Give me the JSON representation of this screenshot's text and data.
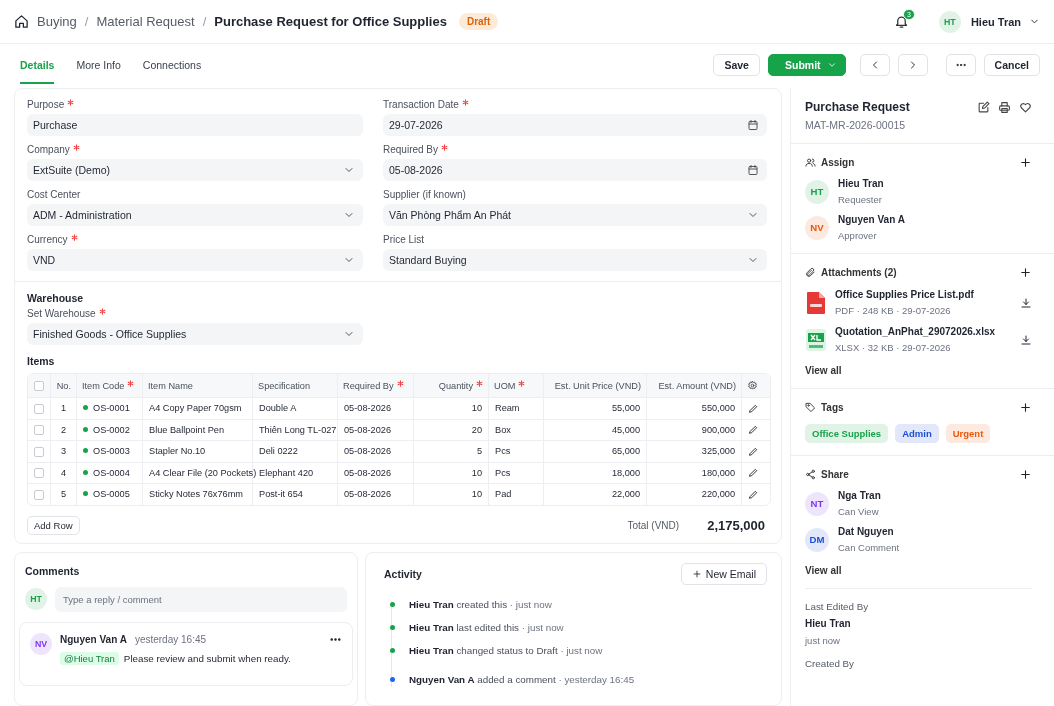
{
  "breadcrumb": [
    {
      "label": "Buying",
      "separator": "/"
    },
    {
      "label": "Material Request",
      "separator": "/"
    }
  ],
  "title": "Purchase Request for Office Supplies",
  "status": "Draft",
  "notifications": "3",
  "user": {
    "initials": "HT",
    "name": "Hieu Tran",
    "color": "#16a34a"
  },
  "tabs": [
    {
      "label": "Details",
      "selected": true
    },
    {
      "label": "More Info",
      "selected": false
    },
    {
      "label": "Connections",
      "selected": false
    }
  ],
  "actions": [
    {
      "kind": "secondary",
      "label": "Save"
    },
    {
      "kind": "primary",
      "label": "Submit"
    },
    {
      "kind": "prev"
    },
    {
      "kind": "next"
    },
    {
      "kind": "more"
    },
    {
      "kind": "secondary",
      "label": "Cancel"
    }
  ],
  "fields": [
    {
      "label": "Purpose",
      "required": true,
      "value": "Purchase",
      "kind": "text"
    },
    {
      "label": "Transaction Date",
      "required": true,
      "value": "29-07-2026",
      "kind": "date"
    },
    {
      "label": "Company",
      "required": true,
      "value": "ExtSuite (Demo)",
      "kind": "select"
    },
    {
      "label": "Required By",
      "required": true,
      "value": "05-08-2026",
      "kind": "date"
    },
    {
      "label": "Cost Center",
      "required": false,
      "value": "ADM - Administration",
      "kind": "select"
    },
    {
      "label": "Supplier (if known)",
      "required": false,
      "value": "Văn Phòng Phẩm An Phát",
      "kind": "select"
    },
    {
      "label": "Currency",
      "required": true,
      "value": "VND",
      "kind": "select"
    },
    {
      "label": "Price List",
      "required": false,
      "value": "Standard Buying",
      "kind": "select"
    }
  ],
  "warehouse": {
    "heading": "Warehouse",
    "label": "Set Warehouse",
    "required": true,
    "value": "Finished Goods - Office Supplies",
    "kind": "select"
  },
  "items": {
    "heading": "Items",
    "select_all": {
      "checked": false
    },
    "columns": [
      {
        "label": "No.",
        "required": false
      },
      {
        "label": "Item Code",
        "required": true
      },
      {
        "label": "Item Name",
        "required": false
      },
      {
        "label": "Specification",
        "required": false
      },
      {
        "label": "Required By",
        "required": true
      },
      {
        "label": "Quantity",
        "required": true
      },
      {
        "label": "UOM",
        "required": true
      },
      {
        "label": "Est. Unit Price (VND)",
        "required": false
      },
      {
        "label": "Est. Amount (VND)",
        "required": false
      }
    ],
    "rows": [
      {
        "checked": false,
        "no": "1",
        "code": "OS-0001",
        "color": "#16a34a",
        "name": "A4 Copy Paper 70gsm",
        "spec": "Double A",
        "required_by": "05-08-2026",
        "qty": "10",
        "uom": "Ream",
        "price": "55,000",
        "amount": "550,000"
      },
      {
        "checked": false,
        "no": "2",
        "code": "OS-0002",
        "color": "#16a34a",
        "name": "Blue Ballpoint Pen",
        "spec": "Thiên Long TL-027",
        "required_by": "05-08-2026",
        "qty": "20",
        "uom": "Box",
        "price": "45,000",
        "amount": "900,000"
      },
      {
        "checked": false,
        "no": "3",
        "code": "OS-0003",
        "color": "#16a34a",
        "name": "Stapler No.10",
        "spec": "Deli 0222",
        "required_by": "05-08-2026",
        "qty": "5",
        "uom": "Pcs",
        "price": "65,000",
        "amount": "325,000"
      },
      {
        "checked": false,
        "no": "4",
        "code": "OS-0004",
        "color": "#16a34a",
        "name": "A4 Clear File (20 Pockets)",
        "spec": "Elephant 420",
        "required_by": "05-08-2026",
        "qty": "10",
        "uom": "Pcs",
        "price": "18,000",
        "amount": "180,000"
      },
      {
        "checked": false,
        "no": "5",
        "code": "OS-0005",
        "color": "#16a34a",
        "name": "Sticky Notes 76x76mm",
        "spec": "Post-it 654",
        "required_by": "05-08-2026",
        "qty": "10",
        "uom": "Pad",
        "price": "22,000",
        "amount": "220,000"
      }
    ],
    "add_row": "Add Row",
    "total_label": "Total (VND)",
    "total": "2,175,000"
  },
  "comments": {
    "heading": "Comments",
    "avatar": {
      "initials": "HT",
      "color": "#16a34a"
    },
    "placeholder": "Type a reply / comment",
    "list": [
      {
        "initials": "NV",
        "color": "#7c3aed",
        "author": "Nguyen Van A",
        "time": "yesterday 16:45",
        "mention": "@Hieu Tran",
        "text": "Please review and submit when ready."
      }
    ]
  },
  "activity": {
    "heading": "Activity",
    "button": "New Email",
    "list": [
      {
        "actor": "Hieu Tran",
        "action": "created this",
        "time": "· just now",
        "color": "#16a34a"
      },
      {
        "actor": "Hieu Tran",
        "action": "last edited this",
        "time": "· just now",
        "color": "#16a34a"
      },
      {
        "actor": "Hieu Tran",
        "action": "changed status to Draft",
        "time": "· just now",
        "color": "#16a34a"
      },
      {
        "actor": "Nguyen Van A",
        "action": "added a comment",
        "time": "· yesterday 16:45",
        "color": "#2563eb"
      }
    ]
  },
  "sidebar": {
    "title": "Purchase Request",
    "doc_id": "MAT-MR-2026-00015",
    "assign": {
      "heading": "Assign",
      "people": [
        {
          "initials": "HT",
          "color": "#16a34a",
          "name": "Hieu Tran",
          "role": "Requester"
        },
        {
          "initials": "NV",
          "color": "#ea580c",
          "name": "Nguyen Van A",
          "role": "Approver"
        }
      ]
    },
    "attachments": {
      "heading": "Attachments (2)",
      "files": [
        {
          "kind": "pdf",
          "name": "Office Supplies Price List.pdf",
          "meta": "PDF · 248 KB · 29-07-2026"
        },
        {
          "kind": "xlsx",
          "name": "Quotation_AnPhat_29072026.xlsx",
          "meta": "XLSX · 32 KB · 29-07-2026"
        }
      ],
      "view_all": "View all"
    },
    "tags": {
      "heading": "Tags",
      "list": [
        {
          "label": "Office Supplies",
          "color": "#16a34a"
        },
        {
          "label": "Admin",
          "color": "#1d4ed8"
        },
        {
          "label": "Urgent",
          "color": "#ea580c"
        }
      ]
    },
    "share": {
      "heading": "Share",
      "people": [
        {
          "initials": "NT",
          "color": "#7c3aed",
          "name": "Nga Tran",
          "role": "Can View"
        },
        {
          "initials": "DM",
          "color": "#1d4ed8",
          "name": "Dat Nguyen",
          "role": "Can Comment"
        }
      ],
      "view_all": "View all"
    },
    "meta": [
      {
        "label": "Last Edited By",
        "name": "Hieu Tran",
        "time": "just now"
      },
      {
        "label": "Created By"
      }
    ]
  }
}
